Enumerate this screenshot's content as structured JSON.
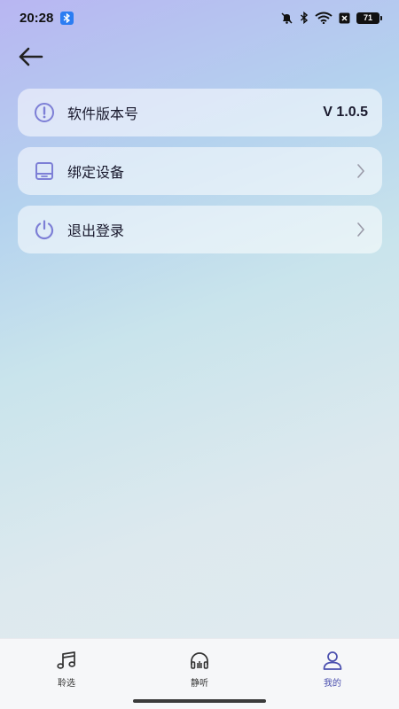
{
  "status_bar": {
    "time": "20:28",
    "battery": "71",
    "icons": [
      "bluetooth-badge-icon",
      "mute-bell-icon",
      "bluetooth-icon",
      "wifi-icon",
      "sim-icon",
      "battery-icon"
    ]
  },
  "header": {
    "back_icon": "arrow-left-icon"
  },
  "menu": {
    "items": [
      {
        "label": "软件版本号",
        "value": "V 1.0.5",
        "icon": "info-circle-icon"
      },
      {
        "label": "绑定设备",
        "icon": "device-icon"
      },
      {
        "label": "退出登录",
        "icon": "power-icon"
      }
    ]
  },
  "tabbar": {
    "tabs": [
      {
        "label": "聆选",
        "icon": "music-note-icon"
      },
      {
        "label": "静听",
        "icon": "headphones-icon"
      },
      {
        "label": "我的",
        "icon": "user-icon",
        "active": true
      }
    ]
  },
  "colors": {
    "accent": "#7d7fd6",
    "active_tab": "#4a4fae",
    "gradient_top": "#b8b6f2",
    "gradient_bottom": "#e1ebf0"
  }
}
